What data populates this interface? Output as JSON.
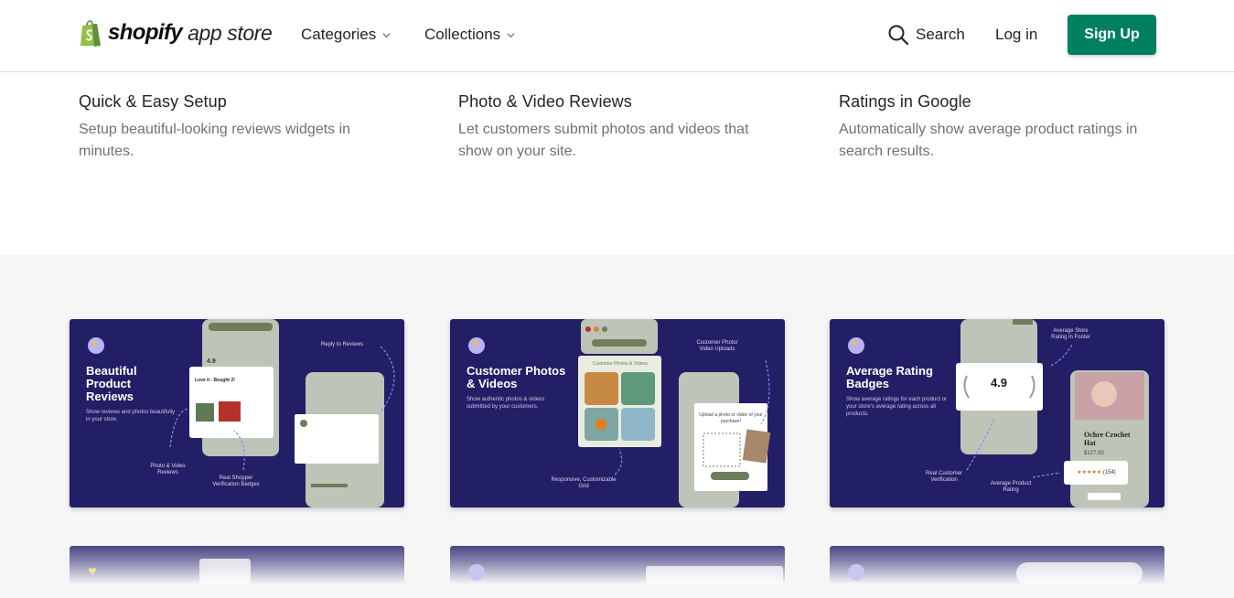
{
  "header": {
    "logo_word": "shopify",
    "logo_sub": "app store",
    "nav": [
      {
        "label": "Categories"
      },
      {
        "label": "Collections"
      }
    ],
    "search_label": "Search",
    "login_label": "Log in",
    "signup_label": "Sign Up",
    "brand_color": "#008060"
  },
  "features": [
    {
      "title": "Quick & Easy Setup",
      "desc": "Setup beautiful-looking reviews widgets in minutes."
    },
    {
      "title": "Photo & Video Reviews",
      "desc": "Let customers submit photos and videos that show on your site."
    },
    {
      "title": "Ratings in Google",
      "desc": "Automatically show average product ratings in search results."
    }
  ],
  "screenshots": [
    {
      "title": "Beautiful Product Reviews",
      "subtitle": "Show reviews and photos beautifully in your store.",
      "annotations": [
        "Reply to Reviews",
        "Photo & Video Reviews",
        "Real Shopper Verification Badges"
      ],
      "rating": "4.9",
      "review_title": "Love it - Bought 2!"
    },
    {
      "title": "Customer Photos & Videos",
      "subtitle": "Show authentic photos & videos submitted by your customers.",
      "annotations": [
        "Customer Photo/ Video Uploads",
        "Responsive, Customizable Grid"
      ],
      "panel_title": "Customer Photos & Videos",
      "upload_text": "Upload a photo or video of your purchase!"
    },
    {
      "title": "Average Rating Badges",
      "subtitle": "Show average ratings for each product or your store's average rating across all products.",
      "annotations": [
        "Average Store Rating in Footer",
        "Real Customer Verification",
        "Average Product Rating"
      ],
      "rating": "4.9",
      "product_name": "Ochre Crochet Hat",
      "price": "$127.00",
      "review_count": "(154)"
    }
  ],
  "card_bg": "#221f66"
}
